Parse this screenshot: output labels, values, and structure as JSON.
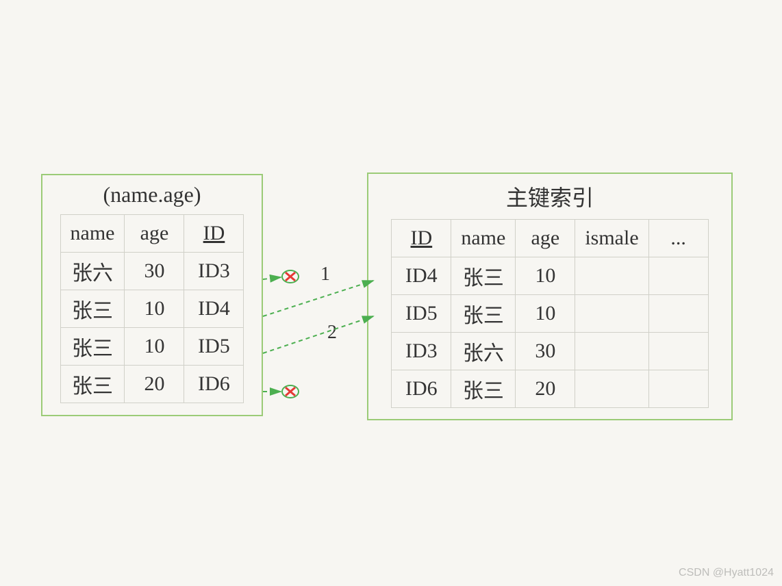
{
  "left_box": {
    "title": "(name.age)",
    "headers": [
      "name",
      "age",
      "ID"
    ],
    "rows": [
      {
        "name": "张六",
        "age": "30",
        "id": "ID3"
      },
      {
        "name": "张三",
        "age": "10",
        "id": "ID4"
      },
      {
        "name": "张三",
        "age": "10",
        "id": "ID5"
      },
      {
        "name": "张三",
        "age": "20",
        "id": "ID6"
      }
    ]
  },
  "right_box": {
    "title": "主键索引",
    "headers": [
      "ID",
      "name",
      "age",
      "ismale",
      "..."
    ],
    "rows": [
      {
        "id": "ID4",
        "name": "张三",
        "age": "10",
        "ismale": "",
        "more": ""
      },
      {
        "id": "ID5",
        "name": "张三",
        "age": "10",
        "ismale": "",
        "more": ""
      },
      {
        "id": "ID3",
        "name": "张六",
        "age": "30",
        "ismale": "",
        "more": ""
      },
      {
        "id": "ID6",
        "name": "张三",
        "age": "20",
        "ismale": "",
        "more": ""
      }
    ]
  },
  "arrows": {
    "label1": "1",
    "label2": "2"
  },
  "watermark": "CSDN @Hyatt1024"
}
